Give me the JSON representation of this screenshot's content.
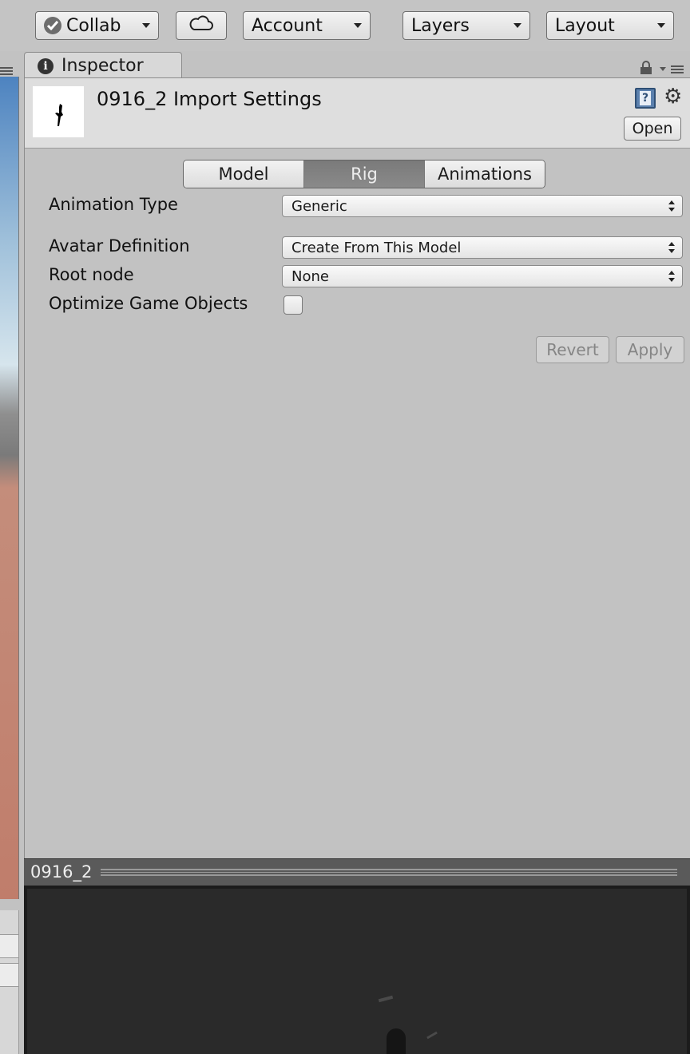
{
  "toolbar": {
    "collab_label": "Collab",
    "account_label": "Account",
    "layers_label": "Layers",
    "layout_label": "Layout"
  },
  "inspector_tab": {
    "label": "Inspector",
    "icon": "info-icon"
  },
  "header": {
    "title": "0916_2 Import Settings",
    "open_label": "Open",
    "icons": [
      "help-book-icon",
      "gear-icon"
    ]
  },
  "tabs": [
    {
      "label": "Model",
      "active": false
    },
    {
      "label": "Rig",
      "active": true
    },
    {
      "label": "Animations",
      "active": false
    }
  ],
  "properties": {
    "animation_type": {
      "label": "Animation Type",
      "value": "Generic"
    },
    "avatar_definition": {
      "label": "Avatar Definition",
      "value": "Create From This Model"
    },
    "root_node": {
      "label": "Root node",
      "value": "None"
    },
    "optimize_game_objects": {
      "label": "Optimize Game Objects",
      "checked": false
    }
  },
  "actions": {
    "revert_label": "Revert",
    "apply_label": "Apply"
  },
  "preview": {
    "title": "0916_2"
  },
  "colors": {
    "panel_bg": "#c2c2c2",
    "active_tab_bg": "#7f7f7f",
    "preview_bg": "#2a2a2a"
  }
}
